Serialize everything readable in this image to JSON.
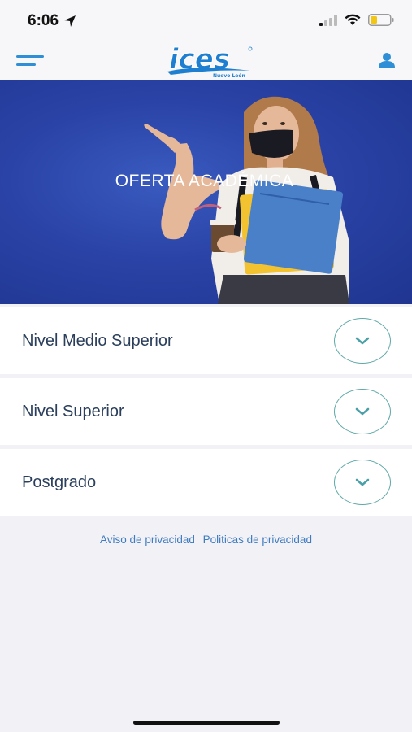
{
  "status": {
    "time": "6:06"
  },
  "brand": {
    "logo_text": "ices",
    "logo_subtitle": "Nuevo León"
  },
  "hero": {
    "title": "OFERTA ACADÉMICA"
  },
  "levels": [
    {
      "label": "Nivel Medio Superior"
    },
    {
      "label": "Nivel Superior"
    },
    {
      "label": "Postgrado"
    }
  ],
  "footer": {
    "privacy_notice": "Aviso de privacidad",
    "privacy_policies": "Politicas de privacidad"
  },
  "colors": {
    "hero_blue": "#2a43a6",
    "accent_teal": "#5fa8a8",
    "link_blue": "#3f7bc0",
    "label_navy": "#2b3f5c",
    "logo_blue": "#1e7fd0"
  },
  "icons": [
    "location-arrow-icon",
    "signal-icon",
    "wifi-icon",
    "battery-icon",
    "menu-icon",
    "user-icon",
    "chevron-down-icon"
  ]
}
